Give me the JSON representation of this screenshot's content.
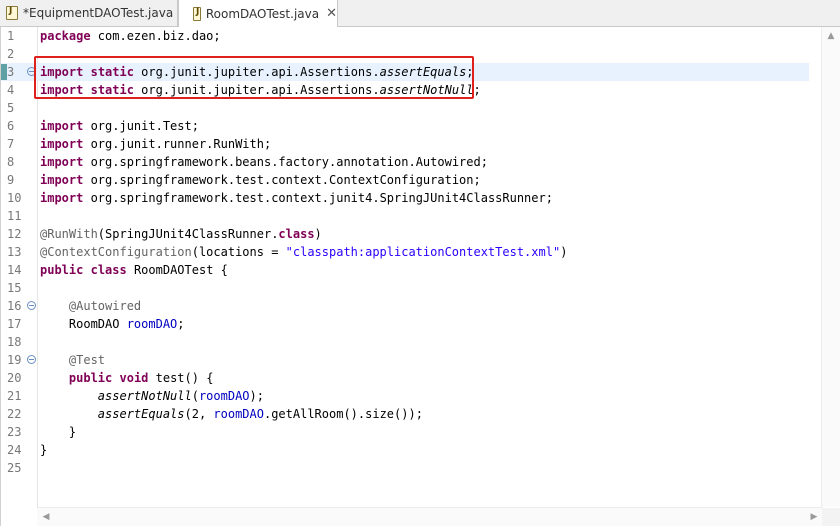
{
  "tabs": [
    {
      "label": "*EquipmentDAOTest.java",
      "active": false
    },
    {
      "label": "RoomDAOTest.java",
      "active": true
    }
  ],
  "editor": {
    "current_line": 3,
    "lines": [
      {
        "n": "1",
        "html": "<span class=\"kw\">package</span> com.ezen.biz.dao;"
      },
      {
        "n": "2",
        "html": ""
      },
      {
        "n": "3",
        "html": "<span class=\"kw\">import</span> <span class=\"kw\">static</span> org.junit.jupiter.api.Assertions.<span class=\"ital\">assertEquals</span>;"
      },
      {
        "n": "4",
        "html": "<span class=\"kw\">import</span> <span class=\"kw\">static</span> org.junit.jupiter.api.Assertions.<span class=\"ital\">assertNotNull</span>;"
      },
      {
        "n": "5",
        "html": ""
      },
      {
        "n": "6",
        "html": "<span class=\"kw\">import</span> org.junit.Test;"
      },
      {
        "n": "7",
        "html": "<span class=\"kw\">import</span> org.junit.runner.RunWith;"
      },
      {
        "n": "8",
        "html": "<span class=\"kw\">import</span> org.springframework.beans.factory.annotation.Autowired;"
      },
      {
        "n": "9",
        "html": "<span class=\"kw\">import</span> org.springframework.test.context.ContextConfiguration;"
      },
      {
        "n": "10",
        "html": "<span class=\"kw\">import</span> org.springframework.test.context.junit4.SpringJUnit4ClassRunner;"
      },
      {
        "n": "11",
        "html": ""
      },
      {
        "n": "12",
        "html": "<span class=\"ann\">@RunWith</span>(SpringJUnit4ClassRunner.<span class=\"kw\">class</span>)"
      },
      {
        "n": "13",
        "html": "<span class=\"ann\">@ContextConfiguration</span>(locations = <span class=\"str\">\"classpath:applicationContextTest.xml\"</span>)"
      },
      {
        "n": "14",
        "html": "<span class=\"kw\">public</span> <span class=\"kw\">class</span> RoomDAOTest {"
      },
      {
        "n": "15",
        "html": ""
      },
      {
        "n": "16",
        "html": "    <span class=\"ann\">@Autowired</span>"
      },
      {
        "n": "17",
        "html": "    RoomDAO <span class=\"field\">roomDAO</span>;"
      },
      {
        "n": "18",
        "html": ""
      },
      {
        "n": "19",
        "html": "    <span class=\"ann\">@Test</span>"
      },
      {
        "n": "20",
        "html": "    <span class=\"kw\">public</span> <span class=\"kw\">void</span> test() {"
      },
      {
        "n": "21",
        "html": "        <span class=\"ital\">assertNotNull</span>(<span class=\"field\">roomDAO</span>);"
      },
      {
        "n": "22",
        "html": "        <span class=\"ital\">assertEquals</span>(2, <span class=\"field\">roomDAO</span>.getAllRoom().size());"
      },
      {
        "n": "23",
        "html": "    }"
      },
      {
        "n": "24",
        "html": "}"
      },
      {
        "n": "25",
        "html": ""
      }
    ],
    "fold_lines": [
      3,
      16,
      19
    ]
  },
  "icons": {
    "tab_file": "java-file-icon",
    "close": "close-icon",
    "fold": "fold-collapse-icon"
  },
  "colors": {
    "keyword": "#7f0055",
    "annotation": "#646464",
    "string": "#2a00ff",
    "field": "#0000c0",
    "highlight_box": "#e0201b",
    "current_line": "#e8f2fe"
  }
}
